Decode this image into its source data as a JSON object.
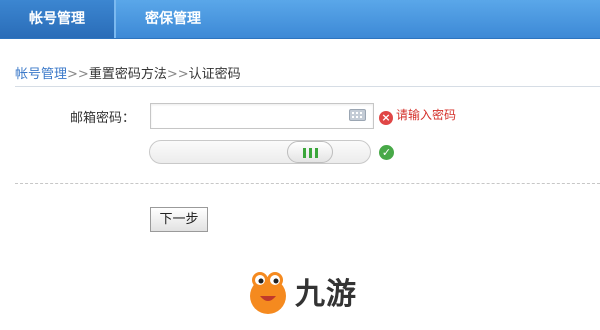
{
  "tabs": [
    {
      "label": "帐号管理",
      "active": true
    },
    {
      "label": "密保管理",
      "active": false
    }
  ],
  "breadcrumb": {
    "link": "帐号管理",
    "sep1": ">>",
    "step": "重置密码方法",
    "sep2": ">>",
    "current": "认证密码"
  },
  "form": {
    "password_label": "邮箱密码：",
    "password_value": "",
    "password_error": "请输入密码",
    "error_icon": "×",
    "ok_icon": "✓"
  },
  "next_button": "下一步",
  "watermark": {
    "text": "九游"
  },
  "colors": {
    "tab_bar": "#3d89d6",
    "link": "#3b79c9",
    "error": "#d4302a",
    "ok": "#48a948"
  }
}
